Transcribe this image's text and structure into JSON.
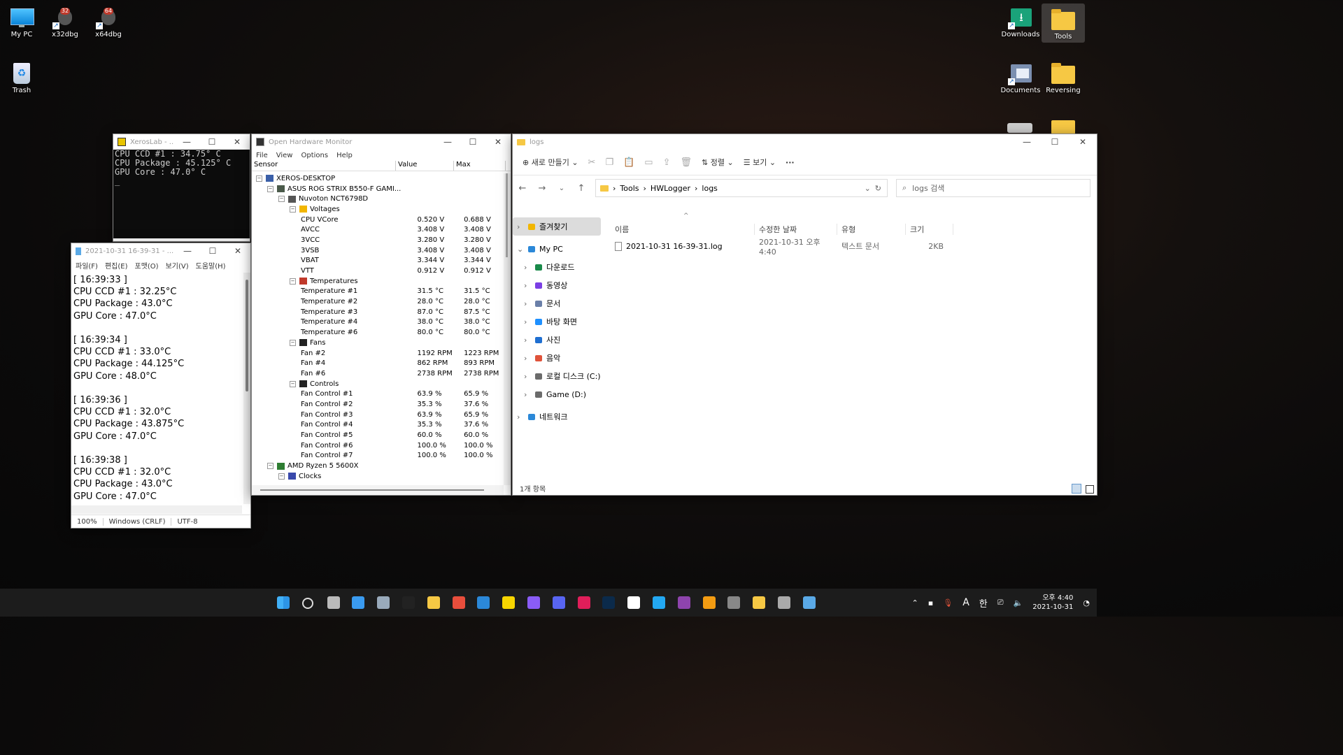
{
  "desktop": {
    "icons": [
      {
        "label": "My PC"
      },
      {
        "label": "x32dbg",
        "badge": "32"
      },
      {
        "label": "x64dbg",
        "badge": "64"
      },
      {
        "label": "Trash"
      },
      {
        "label": "Downloads"
      },
      {
        "label": "Tools"
      },
      {
        "label": "Documents"
      },
      {
        "label": "Reversing"
      }
    ]
  },
  "console": {
    "title": "XerosLab - ...",
    "lines": [
      "CPU CCD #1 : 34.75° C",
      "CPU Package : 45.125° C",
      "GPU Core : 47.0° C",
      "_"
    ]
  },
  "notepad": {
    "title": "2021-10-31 16-39-31 - ...",
    "menu": [
      "파일(F)",
      "편집(E)",
      "포맷(O)",
      "보기(V)",
      "도움말(H)"
    ],
    "content": "[ 16:39:33 ]\nCPU CCD #1 : 32.25°C\nCPU Package : 43.0°C\nGPU Core : 47.0°C\n\n[ 16:39:34 ]\nCPU CCD #1 : 33.0°C\nCPU Package : 44.125°C\nGPU Core : 48.0°C\n\n[ 16:39:36 ]\nCPU CCD #1 : 32.0°C\nCPU Package : 43.875°C\nGPU Core : 47.0°C\n\n[ 16:39:38 ]\nCPU CCD #1 : 32.0°C\nCPU Package : 43.0°C\nGPU Core : 47.0°C",
    "status": {
      "zoom": "100%",
      "eol": "Windows (CRLF)",
      "encoding": "UTF-8"
    }
  },
  "ohm": {
    "title": "Open Hardware Monitor",
    "menu": [
      "File",
      "View",
      "Options",
      "Help"
    ],
    "columns": {
      "sensor": "Sensor",
      "value": "Value",
      "max": "Max"
    },
    "rows": [
      {
        "indent": 0,
        "toggle": "-",
        "icon": "pc",
        "name": "XEROS-DESKTOP",
        "value": "",
        "max": ""
      },
      {
        "indent": 1,
        "toggle": "-",
        "icon": "board",
        "name": "ASUS ROG STRIX B550-F GAMI...",
        "value": "",
        "max": ""
      },
      {
        "indent": 2,
        "toggle": "-",
        "icon": "chip",
        "name": "Nuvoton NCT6798D",
        "value": "",
        "max": ""
      },
      {
        "indent": 3,
        "toggle": "-",
        "icon": "bolt",
        "name": "Voltages",
        "value": "",
        "max": ""
      },
      {
        "indent": 4,
        "name": "CPU VCore",
        "value": "0.520 V",
        "max": "0.688 V"
      },
      {
        "indent": 4,
        "name": "AVCC",
        "value": "3.408 V",
        "max": "3.408 V"
      },
      {
        "indent": 4,
        "name": "3VCC",
        "value": "3.280 V",
        "max": "3.280 V"
      },
      {
        "indent": 4,
        "name": "3VSB",
        "value": "3.408 V",
        "max": "3.408 V"
      },
      {
        "indent": 4,
        "name": "VBAT",
        "value": "3.344 V",
        "max": "3.344 V"
      },
      {
        "indent": 4,
        "name": "VTT",
        "value": "0.912 V",
        "max": "0.912 V"
      },
      {
        "indent": 3,
        "toggle": "-",
        "icon": "thermo",
        "name": "Temperatures",
        "value": "",
        "max": ""
      },
      {
        "indent": 4,
        "name": "Temperature #1",
        "value": "31.5 °C",
        "max": "31.5 °C"
      },
      {
        "indent": 4,
        "name": "Temperature #2",
        "value": "28.0 °C",
        "max": "28.0 °C"
      },
      {
        "indent": 4,
        "name": "Temperature #3",
        "value": "87.0 °C",
        "max": "87.5 °C"
      },
      {
        "indent": 4,
        "name": "Temperature #4",
        "value": "38.0 °C",
        "max": "38.0 °C"
      },
      {
        "indent": 4,
        "name": "Temperature #6",
        "value": "80.0 °C",
        "max": "80.0 °C"
      },
      {
        "indent": 3,
        "toggle": "-",
        "icon": "fan",
        "name": "Fans",
        "value": "",
        "max": ""
      },
      {
        "indent": 4,
        "name": "Fan #2",
        "value": "1192 RPM",
        "max": "1223 RPM"
      },
      {
        "indent": 4,
        "name": "Fan #4",
        "value": "862 RPM",
        "max": "893 RPM"
      },
      {
        "indent": 4,
        "name": "Fan #6",
        "value": "2738 RPM",
        "max": "2738 RPM"
      },
      {
        "indent": 3,
        "toggle": "-",
        "icon": "knob",
        "name": "Controls",
        "value": "",
        "max": ""
      },
      {
        "indent": 4,
        "name": "Fan Control #1",
        "value": "63.9 %",
        "max": "65.9 %"
      },
      {
        "indent": 4,
        "name": "Fan Control #2",
        "value": "35.3 %",
        "max": "37.6 %"
      },
      {
        "indent": 4,
        "name": "Fan Control #3",
        "value": "63.9 %",
        "max": "65.9 %"
      },
      {
        "indent": 4,
        "name": "Fan Control #4",
        "value": "35.3 %",
        "max": "37.6 %"
      },
      {
        "indent": 4,
        "name": "Fan Control #5",
        "value": "60.0 %",
        "max": "60.0 %"
      },
      {
        "indent": 4,
        "name": "Fan Control #6",
        "value": "100.0 %",
        "max": "100.0 %"
      },
      {
        "indent": 4,
        "name": "Fan Control #7",
        "value": "100.0 %",
        "max": "100.0 %"
      },
      {
        "indent": 1,
        "toggle": "-",
        "icon": "cpu",
        "name": "AMD Ryzen 5 5600X",
        "value": "",
        "max": ""
      },
      {
        "indent": 2,
        "toggle": "-",
        "icon": "clock",
        "name": "Clocks",
        "value": "",
        "max": ""
      }
    ]
  },
  "explorer": {
    "title": "logs",
    "toolbar": {
      "new": "새로 만들기",
      "sort": "정렬",
      "view": "보기",
      "more": "···"
    },
    "breadcrumb": [
      "Tools",
      "HWLogger",
      "logs"
    ],
    "search_placeholder": "logs 검색",
    "nav": [
      {
        "label": "즐겨찾기",
        "icon": "star-icon",
        "color": "#f2b600"
      },
      {
        "label": "My PC",
        "icon": "pc-icon",
        "color": "#2b88d8"
      },
      {
        "label": "다운로드",
        "icon": "download-icon",
        "color": "#1a8a4a"
      },
      {
        "label": "동영상",
        "icon": "video-icon",
        "color": "#7b3fe4"
      },
      {
        "label": "문서",
        "icon": "document-icon",
        "color": "#6a7fa8"
      },
      {
        "label": "바탕 화면",
        "icon": "desktop-icon",
        "color": "#1e90ff"
      },
      {
        "label": "사진",
        "icon": "picture-icon",
        "color": "#1f6fd1"
      },
      {
        "label": "음악",
        "icon": "music-icon",
        "color": "#e0533a"
      },
      {
        "label": "로컬 디스크 (C:)",
        "icon": "drive-c-icon",
        "color": "#6b6b6b"
      },
      {
        "label": "Game (D:)",
        "icon": "drive-d-icon",
        "color": "#6b6b6b"
      },
      {
        "label": "네트워크",
        "icon": "network-icon",
        "color": "#2b88d8"
      }
    ],
    "columns": {
      "name": "이름",
      "date": "수정한 날짜",
      "type": "유형",
      "size": "크기"
    },
    "files": [
      {
        "name": "2021-10-31 16-39-31.log",
        "date": "2021-10-31 오후 4:40",
        "type": "텍스트 문서",
        "size": "2KB"
      }
    ],
    "status": "1개 항목"
  },
  "taskbar": {
    "apps": [
      "start",
      "search",
      "task-view",
      "widgets",
      "resource-monitor",
      "terminal",
      "file-explorer",
      "chrome",
      "edge",
      "kakaotalk",
      "messenger",
      "discord",
      "slack",
      "photoshop",
      "github",
      "vscode",
      "visual-studio",
      "sublime",
      "unity",
      "hwlogger",
      "misc",
      "notepad"
    ],
    "tray": {
      "ime": "A",
      "lang": "한",
      "time": "오후 4:40",
      "date": "2021-10-31"
    }
  }
}
